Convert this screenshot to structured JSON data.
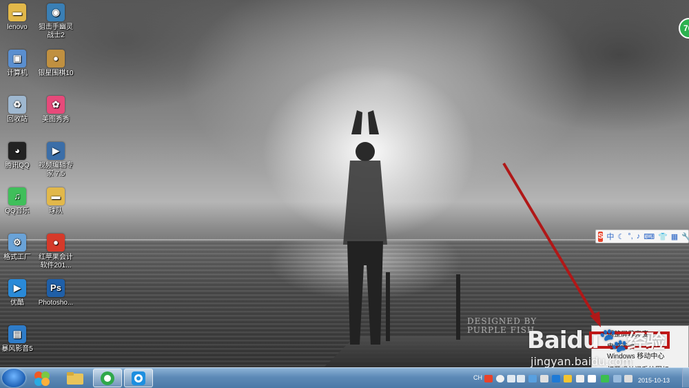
{
  "desktop": {
    "icons": [
      {
        "label": "lenovo",
        "icon": "folder-icon",
        "color": "#e2b84a"
      },
      {
        "label": "狙击手幽灵战士2",
        "icon": "game-icon",
        "color": "#3a7fb5"
      },
      {
        "label": "计算机",
        "icon": "computer-icon",
        "color": "#5a8fd0"
      },
      {
        "label": "银星围棋10",
        "icon": "go-game-icon",
        "color": "#c09040"
      },
      {
        "label": "回收站",
        "icon": "recycle-bin-icon",
        "color": "#9fb8d0"
      },
      {
        "label": "美图秀秀",
        "icon": "meitu-icon",
        "color": "#e74a7a"
      },
      {
        "label": "腾讯QQ",
        "icon": "qq-icon",
        "color": "#222222"
      },
      {
        "label": "视频编辑专家 7.5",
        "icon": "video-editor-icon",
        "color": "#3b6ea8"
      },
      {
        "label": "QQ音乐",
        "icon": "qq-music-icon",
        "color": "#3fbf5a"
      },
      {
        "label": "球队",
        "icon": "folder-icon",
        "color": "#e2b84a"
      },
      {
        "label": "格式工厂",
        "icon": "format-factory-icon",
        "color": "#6aa3d8"
      },
      {
        "label": "红苹果会计软件201...",
        "icon": "red-apple-icon",
        "color": "#d63a2a"
      },
      {
        "label": "优酷",
        "icon": "youku-icon",
        "color": "#2a8ad8"
      },
      {
        "label": "Photosho...",
        "icon": "photoshop-icon",
        "color": "#1f5fa8"
      },
      {
        "label": "暴风影音5",
        "icon": "baofeng-icon",
        "color": "#2e7cc9"
      }
    ]
  },
  "ime_bar": {
    "logo": "S",
    "mode": "中"
  },
  "context_menu": {
    "items": [
      "调整屏幕亮度",
      "电源选项",
      "Windows 移动中心",
      "打开或关闭系统图标"
    ]
  },
  "watermark": {
    "designed": "DESIGNED BY",
    "purple": "PURPLE FISH",
    "baidu": "Baidu",
    "baidu_cn": "经验",
    "jingyan": "jingyan.baidu.com"
  },
  "taskbar": {
    "lang": "CH",
    "clock_date": "2015-10-13"
  },
  "colors": {
    "arrow": "#b01818",
    "highlight": "#c01818",
    "taskbar": "#5d8ab7"
  }
}
